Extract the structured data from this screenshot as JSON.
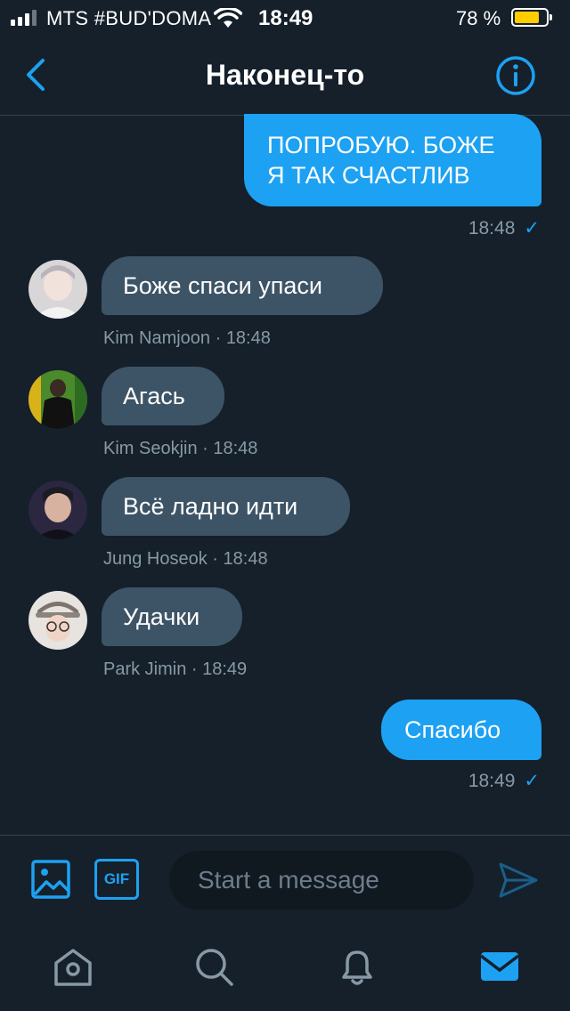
{
  "status_bar": {
    "carrier": "MTS #BUD'DOMA",
    "time": "18:49",
    "battery_percent": "78 %",
    "battery_level": 0.78
  },
  "header": {
    "title": "Наконец-то"
  },
  "messages": [
    {
      "direction": "outgoing",
      "lines": [
        "ПОПРОБУЮ. БОЖЕ",
        "Я ТАК СЧАСТЛИВ"
      ],
      "time": "18:48",
      "status_icon": "check-icon"
    },
    {
      "direction": "incoming",
      "text": "Боже спаси упаси",
      "sender": "Kim Namjoon",
      "meta": "Kim Namjoon · 18:48"
    },
    {
      "direction": "incoming",
      "text": "Агась",
      "sender": "Kim Seokjin",
      "meta": "Kim Seokjin · 18:48"
    },
    {
      "direction": "incoming",
      "text": "Всё ладно идти",
      "sender": "Jung Hoseok",
      "meta": "Jung Hoseok · 18:48"
    },
    {
      "direction": "incoming",
      "text": "Удачки",
      "sender": "Park Jimin",
      "meta": "Park Jimin · 18:49"
    },
    {
      "direction": "outgoing",
      "text": "Спасибо",
      "time": "18:49",
      "status_icon": "check-icon"
    }
  ],
  "composer": {
    "placeholder": "Start a message",
    "gif_label": "GIF"
  },
  "tabbar": [
    "home-icon",
    "search-icon",
    "bell-icon",
    "mail-icon"
  ],
  "colors": {
    "background": "#15202b",
    "accent": "#1da1f2",
    "incoming_bubble": "#3d5466",
    "muted_text": "#8899a6"
  }
}
